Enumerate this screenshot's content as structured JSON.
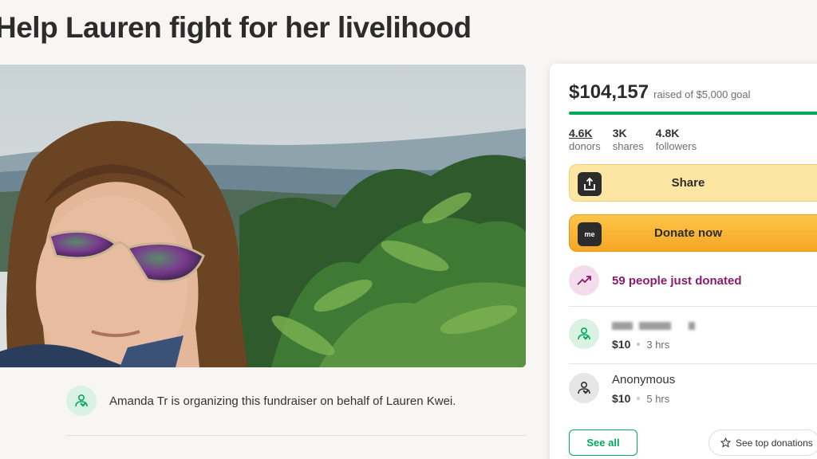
{
  "campaign": {
    "title": "Help Lauren fight for her livelihood"
  },
  "organizer": {
    "text": "Amanda Tr is organizing this fundraiser on behalf of Lauren Kwei."
  },
  "donation_card": {
    "raised": "$104,157",
    "goal_text": "raised of $5,000 goal",
    "progress_fraction": 1.0,
    "stats": [
      {
        "value": "4.6K",
        "label": "donors"
      },
      {
        "value": "3K",
        "label": "shares"
      },
      {
        "value": "4.8K",
        "label": "followers"
      }
    ],
    "share_label": "Share",
    "donate_label": "Donate now",
    "donate_icon_text": "me",
    "trend_text": "59 people just donated",
    "donations": [
      {
        "name": "",
        "amount": "$10",
        "time": "3 hrs"
      },
      {
        "name": "Anonymous",
        "amount": "$10",
        "time": "5 hrs"
      }
    ],
    "see_all_label": "See all",
    "see_top_label": "See top donations"
  },
  "colors": {
    "brand_green": "#02a95c",
    "trend_purple": "#8a1b6b",
    "share_bg": "#fde6a3",
    "donate_bg": "#f5a623"
  },
  "icons": {
    "share": "share-icon",
    "donate": "gofundme-logo-icon",
    "trend": "trending-up-icon",
    "donor": "heart-hand-icon",
    "star": "star-icon"
  }
}
